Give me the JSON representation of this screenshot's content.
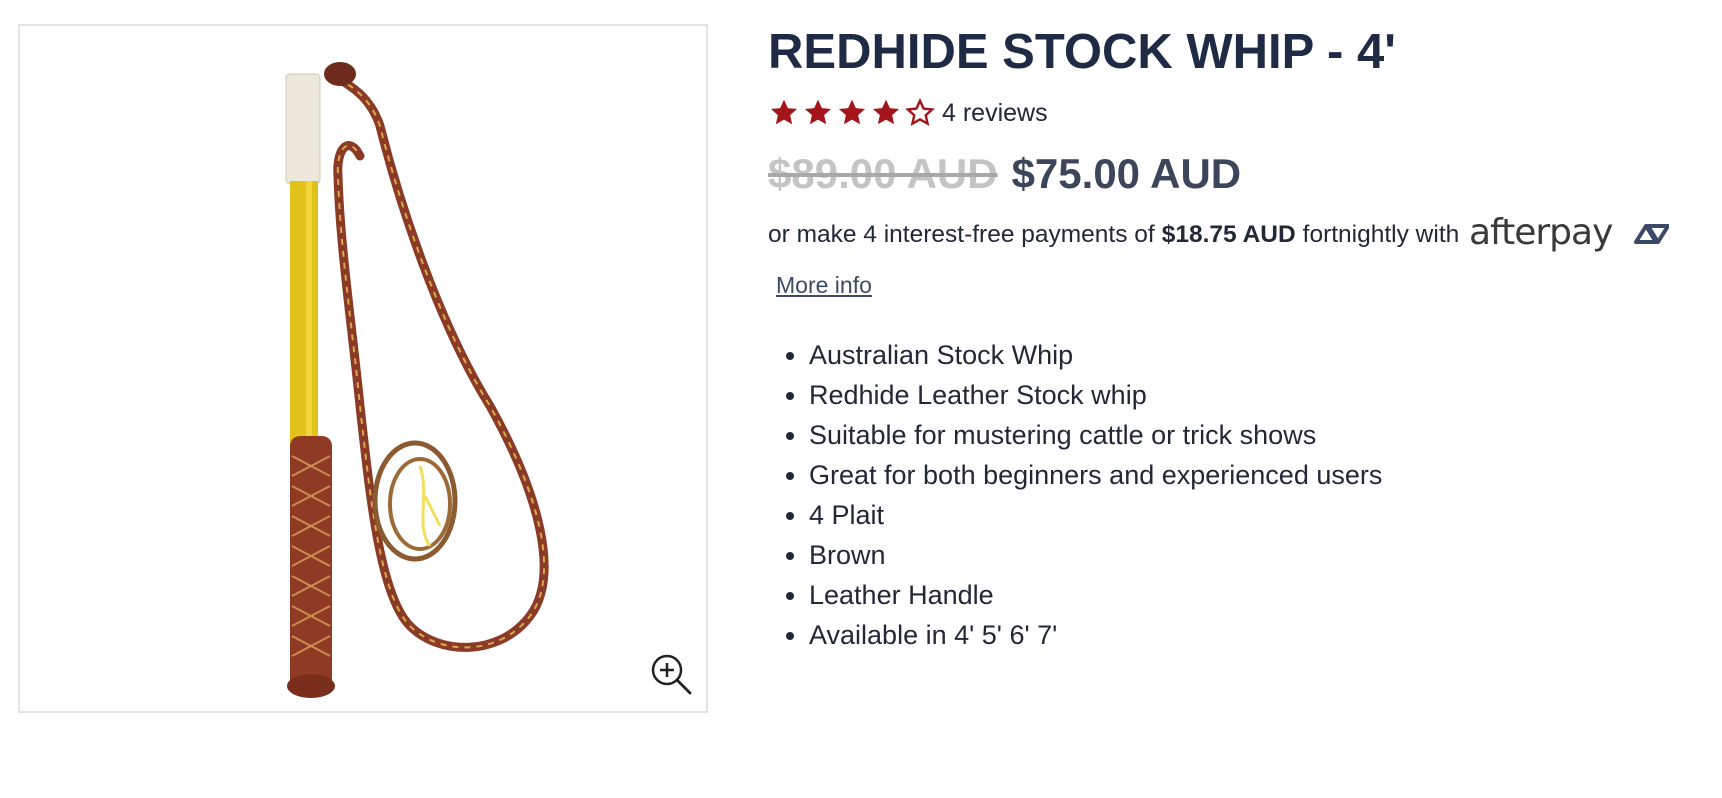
{
  "product": {
    "title": "REDHIDE STOCK WHIP - 4'",
    "rating": {
      "value": 4,
      "max": 5,
      "reviews_label": "4 reviews"
    },
    "price": {
      "original": "$89.00 AUD",
      "sale": "$75.00 AUD"
    },
    "afterpay": {
      "prefix": "or make 4 interest-free payments of",
      "installment": "$18.75 AUD",
      "suffix": "fortnightly with",
      "brand": "afterpay",
      "more_info": "More info"
    },
    "features": [
      "Australian Stock Whip",
      "Redhide Leather Stock whip",
      "Suitable for mustering cattle or trick shows",
      "Great for both beginners and experienced users",
      "4 Plait",
      "Brown",
      "Leather Handle",
      "Available in 4' 5' 6' 7'"
    ]
  },
  "colors": {
    "title": "#1f2a44",
    "star": "#a3141b",
    "price_old": "#c4c4c4",
    "price_new": "#3c4559",
    "afterpay_mint": "#3a4a66"
  },
  "icons": {
    "zoom": "zoom-in-icon",
    "star": "star-icon"
  }
}
